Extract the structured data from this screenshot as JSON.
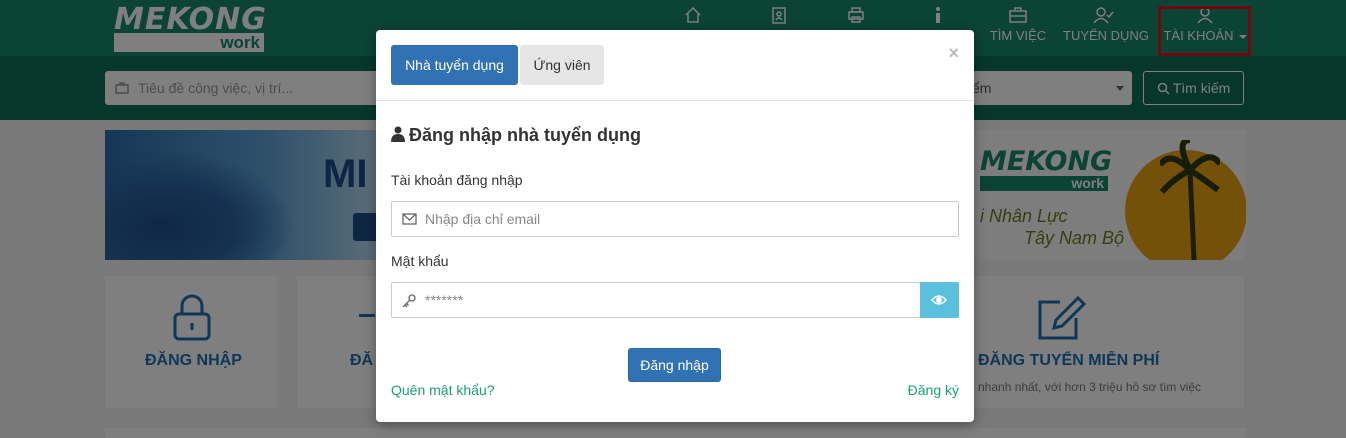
{
  "header": {
    "logo_top": "MEKONG",
    "logo_bottom": "work",
    "nav": [
      {
        "label": "",
        "icon": "home-icon"
      },
      {
        "label": "",
        "icon": "id-card-icon"
      },
      {
        "label": "",
        "icon": "printer-icon"
      },
      {
        "label": "",
        "icon": "info-icon"
      },
      {
        "label": "TÌM VIỆC",
        "icon": "briefcase-icon"
      },
      {
        "label": "TUYỂN DỤNG",
        "icon": "user-check-icon"
      },
      {
        "label": "TÀI KHOẢN",
        "icon": "user-icon"
      }
    ]
  },
  "search": {
    "placeholder": "Tiêu đề công việc, vị trí...",
    "location_value": "ểm",
    "button_label": "Tìm kiếm"
  },
  "banners": {
    "left_text": "MI",
    "right_logo_top": "MEKONG",
    "right_logo_bottom": "work",
    "right_line1": "i Nhân Lực",
    "right_line2": "Tây Nam Bộ"
  },
  "cards": {
    "login_title": "ĐĂNG NHẬP",
    "register_title": "ĐĂ",
    "post_title": "ĐĂNG TUYỂN MIỄN PHÍ",
    "post_sub": "nhanh nhất, với hơn 3 triệu hồ sơ tìm việc"
  },
  "modal": {
    "close_label": "×",
    "tabs": [
      {
        "label": "Nhà tuyển dụng",
        "active": true
      },
      {
        "label": "Ứng viên",
        "active": false
      }
    ],
    "heading": "Đăng nhập nhà tuyển dụng",
    "username_label": "Tài khoản đăng nhập",
    "username_placeholder": "Nhập địa chỉ email",
    "password_label": "Mật khẩu",
    "password_value": "*******",
    "login_button": "Đăng nhập",
    "forgot_link": "Quên mật khẩu?",
    "register_link": "Đăng ký"
  },
  "colors": {
    "brand_green": "#17876a",
    "primary_blue": "#3072b4",
    "info_cyan": "#5bc0de",
    "highlight_red": "#e0101a"
  }
}
